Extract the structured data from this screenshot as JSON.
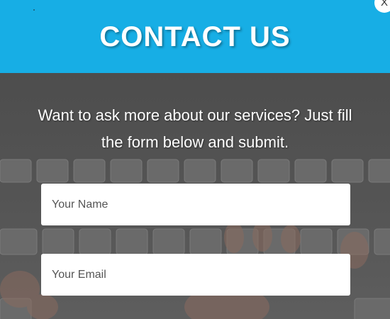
{
  "header": {
    "title": "CONTACT US",
    "close_label": "X",
    "background_color": "#17aee5"
  },
  "intro": {
    "text": "Want to ask more about our services? Just fill the form below and submit."
  },
  "form": {
    "name_placeholder": "Your Name",
    "email_placeholder": "Your Email"
  },
  "icons": {
    "close": "close-icon"
  }
}
